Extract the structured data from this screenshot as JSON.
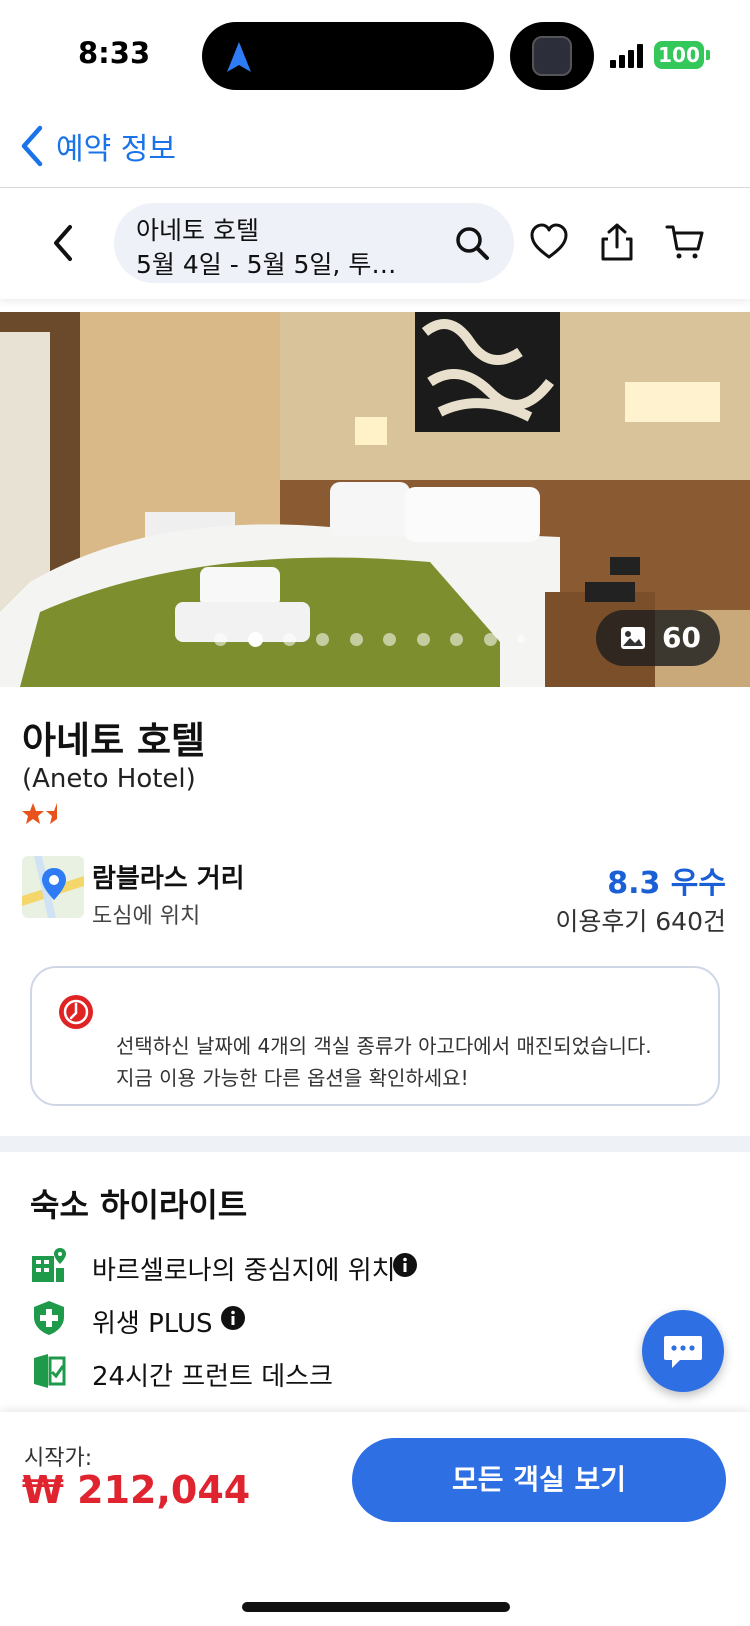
{
  "status_bar": {
    "time": "8:33",
    "battery": "100"
  },
  "outer_nav": {
    "back_label": "예약 정보"
  },
  "header": {
    "search_title": "아네토 호텔",
    "search_sub": "5월 4일 - 5월 5일, 투…"
  },
  "photo": {
    "count": "60",
    "dot_count": 10,
    "active_dot": 1
  },
  "hotel": {
    "name": "아네토 호텔",
    "name_en": "(Aneto Hotel)",
    "stars": 1.5
  },
  "location": {
    "title": "람블라스 거리",
    "subtitle": "도심에 위치"
  },
  "review": {
    "score": "8.3 우수",
    "count": "이용후기 640건"
  },
  "alert": {
    "line1": "선택하신 날짜에 4개의 객실 종류가 아고다에서 매진되었습니다.",
    "line2": "지금 이용 가능한 다른 옵션을 확인하세요!"
  },
  "highlights": {
    "title": "숙소 하이라이트",
    "items": [
      {
        "label": "바르셀로나의 중심지에 위치",
        "icon": "city-location-icon"
      },
      {
        "label": "위생 PLUS",
        "icon": "shield-plus-icon"
      },
      {
        "label": "24시간 프런트 데스크",
        "icon": "front-desk-icon"
      }
    ]
  },
  "bottom": {
    "from_label": "시작가:",
    "price": "₩ 212,044",
    "cta_label": "모든 객실 보기"
  },
  "colors": {
    "accent": "#2f6fe4",
    "price_red": "#e0242f",
    "link_blue": "#1a73e8",
    "rating_blue": "#1a5fd6",
    "green_icon": "#1e9a4a"
  }
}
